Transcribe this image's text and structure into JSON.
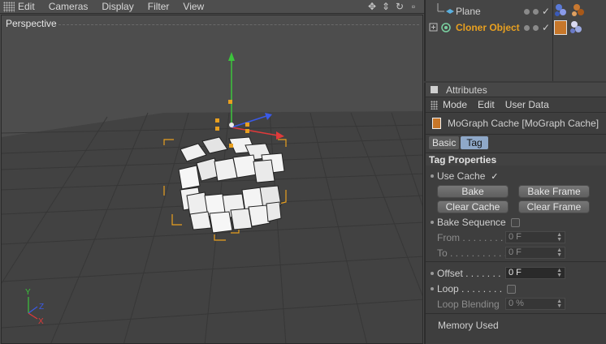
{
  "viewport": {
    "menu": [
      "Edit",
      "Cameras",
      "Display",
      "Filter",
      "View"
    ],
    "title": "Perspective",
    "axis_labels": {
      "y": "Y",
      "z": "Z",
      "x": "X"
    }
  },
  "objects": [
    {
      "name": "Plane",
      "color": "#d0d0d0"
    },
    {
      "name": "Cloner Object",
      "color": "#e8a020"
    }
  ],
  "attributes": {
    "panel_title": "Attributes",
    "menu": [
      "Mode",
      "Edit",
      "User Data"
    ],
    "header": "MoGraph Cache [MoGraph Cache]",
    "tabs": [
      "Basic",
      "Tag"
    ],
    "active_tab": "Tag",
    "section": "Tag Properties",
    "use_cache": {
      "label": "Use Cache",
      "checked": true,
      "mark": "✓"
    },
    "buttons": {
      "bake": "Bake",
      "bake_frame": "Bake Frame",
      "clear_cache": "Clear Cache",
      "clear_frame": "Clear Frame"
    },
    "bake_sequence": {
      "label": "Bake Sequence",
      "checked": false
    },
    "from": {
      "label": "From . . . . . . . . .",
      "value": "0 F"
    },
    "to": {
      "label": "To . . . . . . . . . . .",
      "value": "0 F"
    },
    "offset": {
      "label": "Offset . . . . . . .",
      "value": "0 F"
    },
    "loop": {
      "label": "Loop . . . . . . . .",
      "checked": false
    },
    "loop_blending": {
      "label": "Loop Blending",
      "value": "0 %"
    },
    "memory_used": "Memory Used"
  }
}
